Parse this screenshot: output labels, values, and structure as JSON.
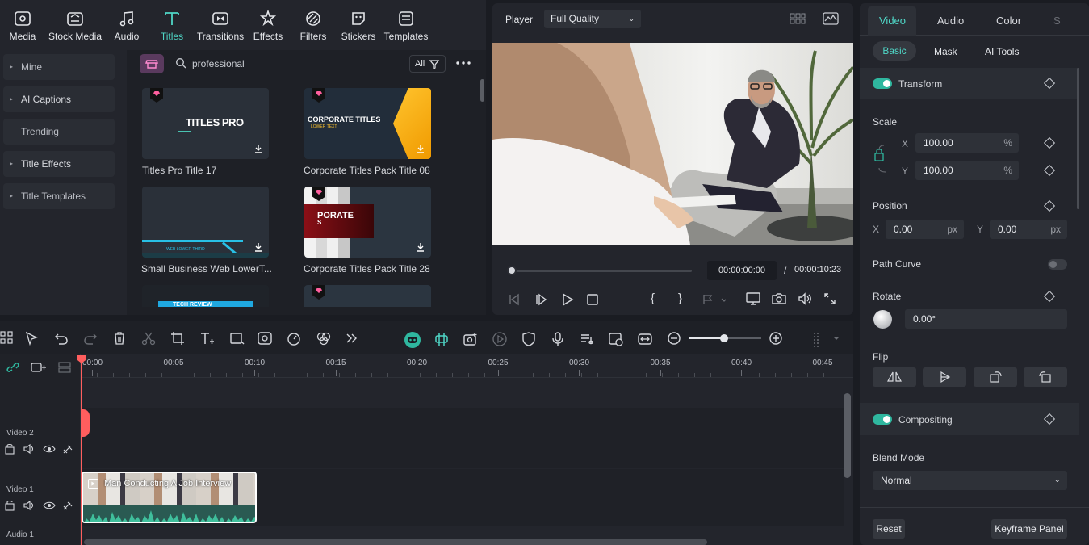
{
  "top_tabs": [
    {
      "label": "Media",
      "icon": "media-icon"
    },
    {
      "label": "Stock Media",
      "icon": "stock-media-icon"
    },
    {
      "label": "Audio",
      "icon": "audio-icon"
    },
    {
      "label": "Titles",
      "icon": "titles-icon"
    },
    {
      "label": "Transitions",
      "icon": "transitions-icon"
    },
    {
      "label": "Effects",
      "icon": "effects-icon"
    },
    {
      "label": "Filters",
      "icon": "filters-icon"
    },
    {
      "label": "Stickers",
      "icon": "stickers-icon"
    },
    {
      "label": "Templates",
      "icon": "templates-icon"
    }
  ],
  "sidebar": {
    "items": [
      {
        "label": "Mine"
      },
      {
        "label": "AI Captions"
      },
      {
        "label": "Trending"
      },
      {
        "label": "Title Effects"
      },
      {
        "label": "Title Templates"
      }
    ]
  },
  "search": {
    "value": "professional",
    "filter_label": "All"
  },
  "cards": [
    {
      "label": "Titles Pro Title 17",
      "thumb_text": "TITLES PRO"
    },
    {
      "label": "Corporate Titles Pack Title 08",
      "thumb_text": "CORPORATE TITLES",
      "thumb_sub": "LOWER TEXT"
    },
    {
      "label": "Small Business Web LowerT...",
      "thumb_text": "WEB LOWER THIRD"
    },
    {
      "label": "Corporate Titles Pack Title 28",
      "thumb_text": "PORATE",
      "thumb_sub": "S"
    },
    {
      "label": "",
      "thumb_text": "TECH REVIEW"
    },
    {
      "label": "",
      "thumb_text": ""
    }
  ],
  "player": {
    "label": "Player",
    "quality": "Full Quality",
    "current_time": "00:00:00:00",
    "separator": "/",
    "total_time": "00:00:10:23",
    "progress": 0.0
  },
  "right_panel": {
    "tabs": [
      {
        "label": "Video"
      },
      {
        "label": "Audio"
      },
      {
        "label": "Color"
      },
      {
        "label": "S"
      }
    ],
    "subtabs": [
      {
        "label": "Basic"
      },
      {
        "label": "Mask"
      },
      {
        "label": "AI Tools"
      }
    ],
    "transform": "Transform",
    "scale": "Scale",
    "x_label": "X",
    "y_label": "Y",
    "scale_x": "100.00",
    "scale_y": "100.00",
    "percent": "%",
    "position": "Position",
    "pos_x": "0.00",
    "pos_y": "0.00",
    "px": "px",
    "path_curve": "Path Curve",
    "rotate": "Rotate",
    "rotate_value": "0.00°",
    "flip": "Flip",
    "compositing": "Compositing",
    "blend_mode": "Blend Mode",
    "blend_value": "Normal",
    "reset": "Reset",
    "keyframe_panel": "Keyframe Panel"
  },
  "timeline": {
    "ticks": [
      "00:00",
      "00:05",
      "00:10",
      "00:15",
      "00:20",
      "00:25",
      "00:30",
      "00:35",
      "00:40",
      "00:45"
    ],
    "tracks": [
      {
        "label": "Video 2"
      },
      {
        "label": "Video 1"
      },
      {
        "label": "Audio 1"
      }
    ],
    "clip_title": "Man Conducting A Job Interview",
    "zoom_level": 0.68
  },
  "colors": {
    "accent": "#4fd6c6",
    "toggle_on": "#2fb79f",
    "playhead": "#ff5e5e",
    "clip_border": "#ffffff",
    "audio_wave": "#3fbf9c"
  }
}
